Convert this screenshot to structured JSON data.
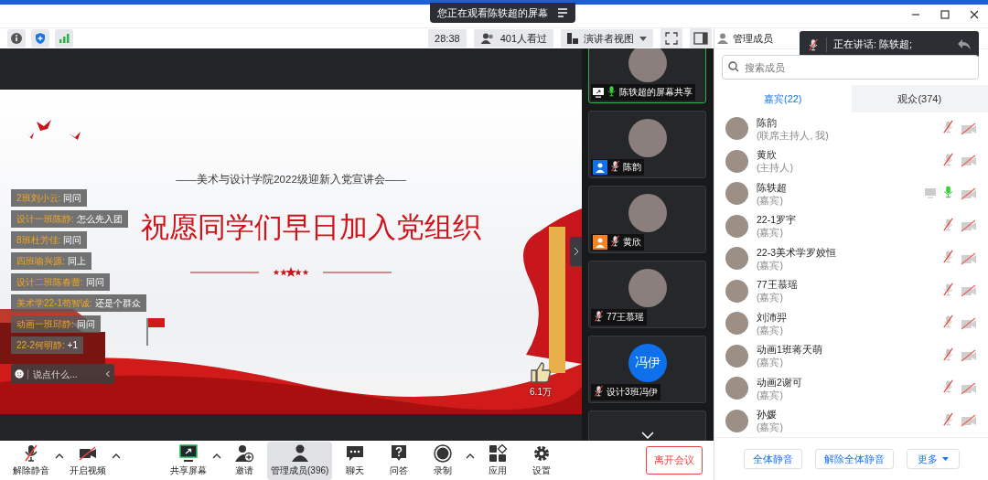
{
  "notice": {
    "text": "您正在观看陈轶超的屏幕"
  },
  "toolbar": {
    "timer": "28:38",
    "viewers": "401人看过",
    "view_mode": "演讲者视图"
  },
  "slide": {
    "subtitle": "——美术与设计学院2022级迎新入党宣讲会——",
    "headline": "祝愿同学们早日加入党组织"
  },
  "chat": {
    "messages": [
      {
        "sender": "2班刘小云:",
        "text": "同问"
      },
      {
        "sender": "设计一班陈静:",
        "text": "怎么先入团"
      },
      {
        "sender": "8班杜芳佳:",
        "text": "同问"
      },
      {
        "sender": "四班喻兴源:",
        "text": "同上"
      },
      {
        "sender": "设计二班陈春蕾:",
        "text": "同问"
      },
      {
        "sender": "美术学22-1苟智诚:",
        "text": "还是个群众"
      },
      {
        "sender": "动画一班邱静:",
        "text": "同问"
      },
      {
        "sender": "22-2何明静:",
        "text": "+1"
      }
    ],
    "placeholder": "说点什么...",
    "likes": "6.1万"
  },
  "video_tiles": [
    {
      "name": "陈轶超的屏幕共享",
      "kind": "screen",
      "selected": true,
      "muted": false
    },
    {
      "name": "陈韵",
      "kind": "photo",
      "selected": false,
      "muted": true,
      "color": "#0e71eb"
    },
    {
      "name": "黄欣",
      "kind": "photo",
      "selected": false,
      "muted": true,
      "color": "#f5811f"
    },
    {
      "name": "77王慕瑶",
      "kind": "photo",
      "selected": false,
      "muted": true
    },
    {
      "name": "设计3班冯伊",
      "kind": "initials",
      "avatar_text": "冯伊",
      "selected": false,
      "muted": true
    }
  ],
  "speaking_toast": {
    "text": "正在讲话: 陈轶超;"
  },
  "panel": {
    "title": "管理成员",
    "search_placeholder": "搜索成员",
    "tabs": [
      {
        "label": "嘉宾(22)",
        "selected": true
      },
      {
        "label": "观众(374)",
        "selected": false
      }
    ],
    "members": [
      {
        "name": "陈韵",
        "role": "(联席主持人, 我)",
        "sharing": false,
        "muted": true
      },
      {
        "name": "黄欣",
        "role": "(主持人)",
        "sharing": false,
        "muted": true
      },
      {
        "name": "陈轶超",
        "role": "(嘉宾)",
        "sharing": true,
        "muted": false
      },
      {
        "name": "22-1罗宇",
        "role": "(嘉宾)",
        "sharing": false,
        "muted": true
      },
      {
        "name": "22-3美术学罗姣恒",
        "role": "(嘉宾)",
        "sharing": false,
        "muted": true
      },
      {
        "name": "77王慕瑶",
        "role": "(嘉宾)",
        "sharing": false,
        "muted": true
      },
      {
        "name": "刘沛羿",
        "role": "(嘉宾)",
        "sharing": false,
        "muted": true
      },
      {
        "name": "动画1班蒋天萌",
        "role": "(嘉宾)",
        "sharing": false,
        "muted": true
      },
      {
        "name": "动画2谢可",
        "role": "(嘉宾)",
        "sharing": false,
        "muted": true
      },
      {
        "name": "孙媛",
        "role": "(嘉宾)",
        "sharing": false,
        "muted": true
      }
    ],
    "buttons": [
      {
        "label": "全体静音",
        "kind": "plain"
      },
      {
        "label": "解除全体静音",
        "kind": "plain"
      },
      {
        "label": "更多",
        "kind": "dropdown"
      }
    ]
  },
  "bottom_bar": {
    "items": [
      {
        "label": "解除静音",
        "kind": "mic",
        "menu": true,
        "selected": false
      },
      {
        "label": "开启视频",
        "kind": "video",
        "menu": true,
        "selected": false
      },
      {
        "label": "共享屏幕",
        "kind": "share",
        "menu": true,
        "selected": false
      },
      {
        "label": "邀请",
        "kind": "invite",
        "menu": false,
        "selected": false
      },
      {
        "label": "管理成员(396)",
        "kind": "members",
        "menu": false,
        "selected": true
      },
      {
        "label": "聊天",
        "kind": "chat",
        "menu": false,
        "selected": false
      },
      {
        "label": "问答",
        "kind": "qa",
        "menu": false,
        "selected": false
      },
      {
        "label": "录制",
        "kind": "record",
        "menu": true,
        "selected": false
      },
      {
        "label": "应用",
        "kind": "apps",
        "menu": false,
        "selected": false
      },
      {
        "label": "设置",
        "kind": "settings",
        "menu": false,
        "selected": false
      }
    ],
    "leave": "离开会议"
  }
}
